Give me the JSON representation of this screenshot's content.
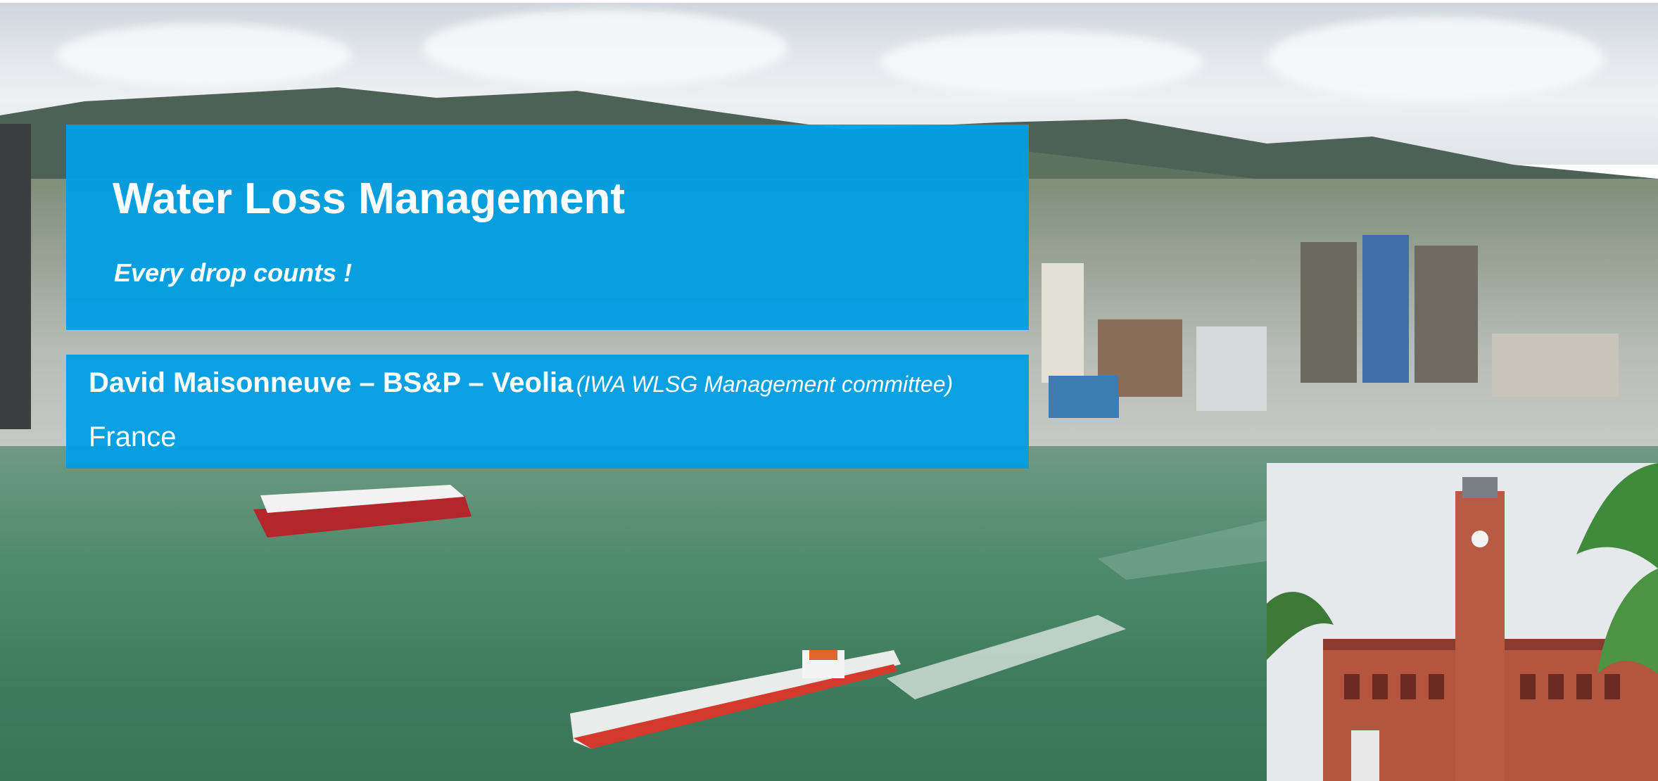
{
  "slide": {
    "title": "Water Loss Management",
    "tagline": "Every drop counts !",
    "presenter": {
      "name_line": "David Maisonneuve  – BS&P – Veolia",
      "role": "(IWA WLSG Management committee)",
      "country": "France"
    }
  },
  "colors": {
    "accent_blue": "#009EE3",
    "side_bar": "#3B3F40",
    "text": "#FFFFFF"
  }
}
